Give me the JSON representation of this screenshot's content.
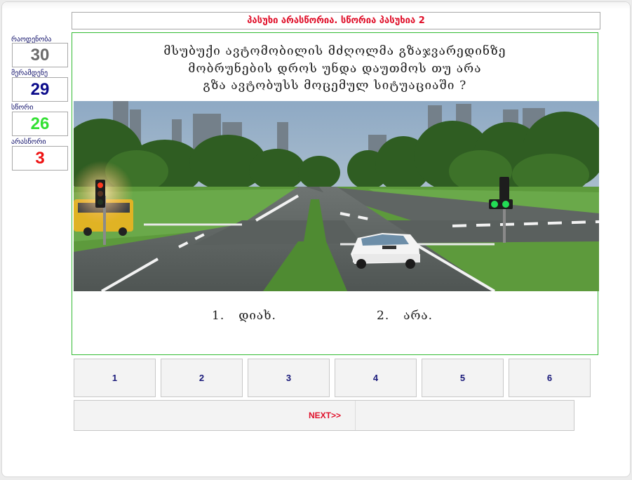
{
  "status_message": "პასუხი არასწორია. სწორია პასუხია 2",
  "stats": [
    {
      "label": "რაოდენობა",
      "value": "30",
      "color": "#6b6b6b"
    },
    {
      "label": "მერამდენე",
      "value": "29",
      "color": "#0a0a8a"
    },
    {
      "label": "სწორი",
      "value": "26",
      "color": "#33e033"
    },
    {
      "label": "არასწორი",
      "value": "3",
      "color": "#ee1111"
    }
  ],
  "question": {
    "lines": [
      "მსუბუქი ავტომობილის მძღოლმა გზაჯვარედინზე",
      "მობრუნების დროს უნდა დაუთმოს თუ არა",
      "გზა ავტობუსს მოცემულ სიტუაციაში ?"
    ],
    "answers": [
      {
        "num": "1.",
        "text": "დიახ."
      },
      {
        "num": "2.",
        "text": "არა."
      }
    ]
  },
  "question_nav": [
    "1",
    "2",
    "3",
    "4",
    "5",
    "6"
  ],
  "next_label": "NEXT>>"
}
